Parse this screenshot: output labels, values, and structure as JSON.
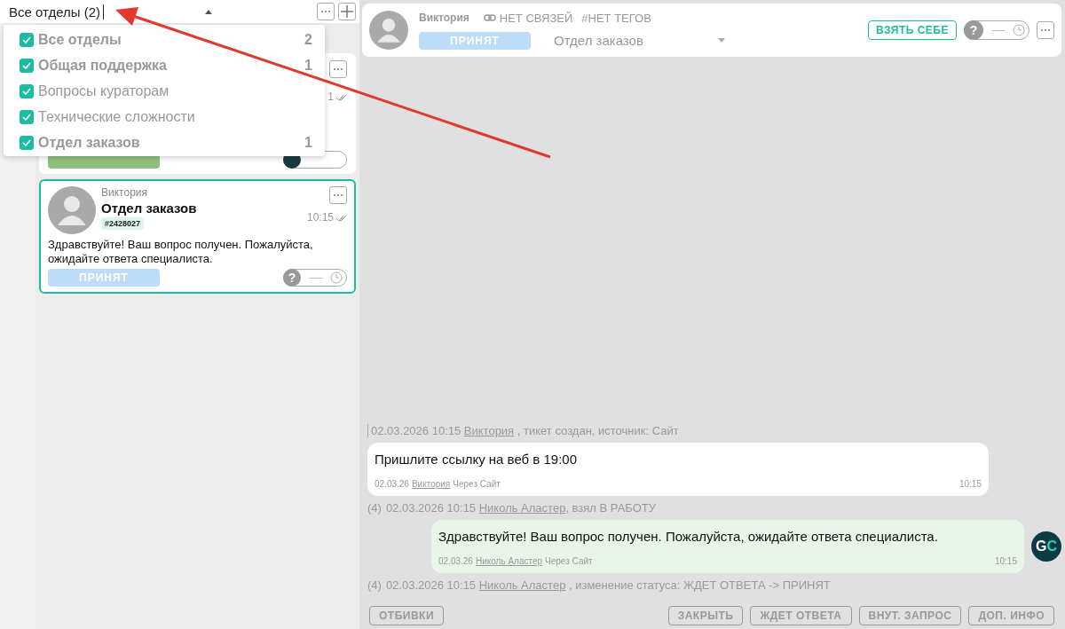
{
  "department_filter": {
    "label": "Все отделы (2)",
    "expanded": true,
    "options": [
      {
        "label": "Все отделы",
        "count": "2",
        "checked": true
      },
      {
        "label": "Общая поддержка",
        "count": "1",
        "checked": true
      },
      {
        "label": "Вопросы кураторам",
        "checked": true
      },
      {
        "label": "Технические сложности",
        "checked": true
      },
      {
        "label": "Отдел заказов",
        "count": "1",
        "checked": true
      }
    ]
  },
  "tickets": [
    {
      "kind": "covered",
      "selected": false,
      "time": "1",
      "color": "#8fc07c"
    },
    {
      "kind": "full",
      "selected": true,
      "author": "Виктория",
      "department": "Отдел заказов",
      "number": "#2428027",
      "time": "10:15",
      "preview": "Здравствуйте! Ваш вопрос получен. Пожалуйста, ожидайте ответа специалиста.",
      "status": "ПРИНЯТ",
      "color": "#bcdcf7",
      "reminder_mark": "?"
    }
  ],
  "ticket_header": {
    "author": "Виктория",
    "links": "НЕТ СВЯЗЕЙ",
    "tags": "#НЕТ ТЕГОВ",
    "status": "ПРИНЯТ",
    "department": "Отдел заказов",
    "take_button": "ВЗЯТЬ СЕБЕ",
    "reminder_mark": "?"
  },
  "timeline": [
    {
      "kind": "system",
      "date": "02.03.2026 10:15",
      "user": "Виктория",
      "text": " , тикет создан, источник: Сайт"
    },
    {
      "kind": "incoming",
      "text": "Пришлите ссылку на веб в 19:00",
      "date": "02.03.26",
      "user": "Виктория",
      "via": "Через Сайт",
      "time": "10:15"
    },
    {
      "kind": "system",
      "prefix": "(4)",
      "date": "02.03.2026 10:15",
      "user": "Николь Аластер",
      "text": ", взял В РАБОТУ"
    },
    {
      "kind": "outgoing",
      "text": "Здравствуйте! Ваш вопрос получен. Пожалуйста, ожидайте ответа специалиста.",
      "date": "02.03.26",
      "user": "Николь Аластер",
      "via": "Через Сайт",
      "time": "10:15",
      "avatar": [
        "G",
        "C"
      ]
    },
    {
      "kind": "system",
      "prefix": "(4)",
      "date": "02.03.2026 10:15",
      "user": "Николь Аластер",
      "text": " , изменение статуса: ЖДЕТ ОТВЕТА -> ПРИНЯТ"
    }
  ],
  "actions_left": [
    "ОТБИВКИ"
  ],
  "actions_right": [
    "ЗАКРЫТЬ",
    "ЖДЕТ ОТВЕТА",
    "ВНУТ. ЗАПРОС",
    "ДОП. ИНФО"
  ]
}
